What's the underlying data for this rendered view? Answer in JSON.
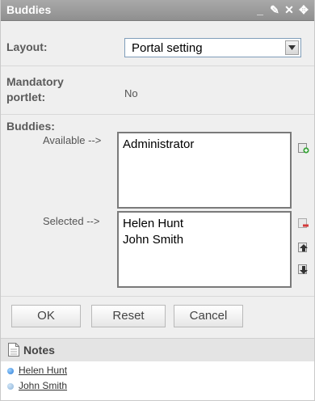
{
  "window": {
    "title": "Buddies"
  },
  "titlebar_controls": [
    {
      "name": "minimize-icon",
      "glyph": "_"
    },
    {
      "name": "edit-icon",
      "glyph": "✎"
    },
    {
      "name": "close-icon",
      "glyph": "✕"
    },
    {
      "name": "move-icon",
      "glyph": "✥"
    }
  ],
  "layout": {
    "label": "Layout:",
    "selected": "Portal setting"
  },
  "mandatory": {
    "label": "Mandatory portlet:",
    "value": "No"
  },
  "buddies": {
    "label": "Buddies:",
    "available_label": "Available -->",
    "available": [
      "Administrator"
    ],
    "selected_label": "Selected -->",
    "selected": [
      "Helen Hunt",
      "John Smith"
    ]
  },
  "buttons": {
    "ok": "OK",
    "reset": "Reset",
    "cancel": "Cancel"
  },
  "notes": {
    "title": "Notes",
    "items": [
      "Helen Hunt",
      "John Smith"
    ]
  }
}
